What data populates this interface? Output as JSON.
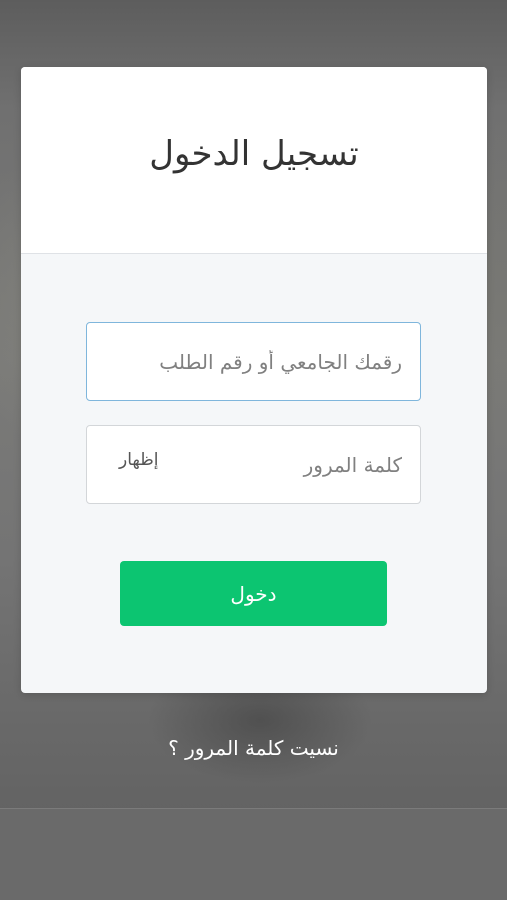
{
  "login": {
    "title": "تسجيل الدخول",
    "username_placeholder": "رقمك الجامعي أو رقم الطلب",
    "username_value": "",
    "password_placeholder": "كلمة المرور",
    "password_value": "",
    "show_password_label": "إظهار",
    "submit_label": "دخول"
  },
  "footer": {
    "forgot_password_label": "نسيت كلمة المرور ؟"
  },
  "colors": {
    "accent": "#0cc571",
    "focus_border": "#7fb6dc"
  }
}
